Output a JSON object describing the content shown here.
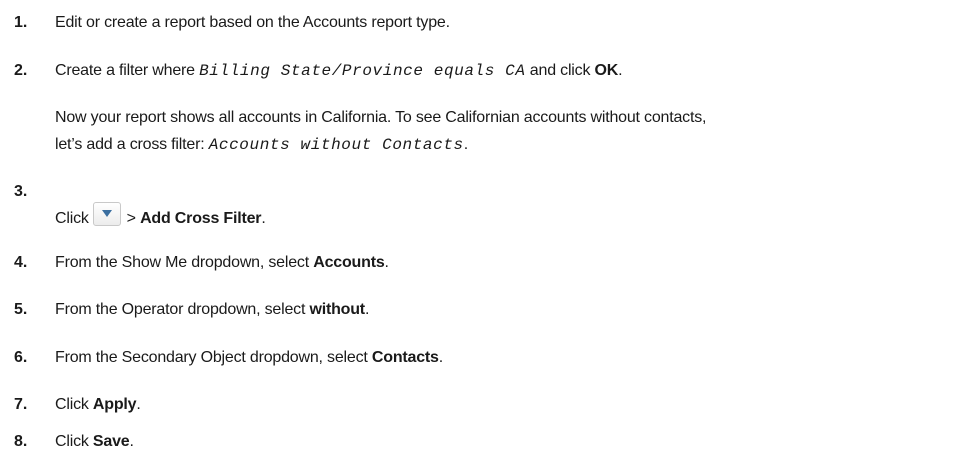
{
  "steps": [
    {
      "num": "1.",
      "text": "Edit or create a report based on the Accounts report type."
    },
    {
      "num": "2.",
      "pre": "Create a filter where ",
      "code": "Billing State/Province equals CA",
      "mid": " and click ",
      "bold": "OK",
      "post": "."
    },
    {
      "note_line1": "Now your report shows all accounts in California. To see Californian accounts without contacts,",
      "note_line2_pre": "let’s add a cross filter: ",
      "note_code": "Accounts without Contacts",
      "note_post": "."
    },
    {
      "num": "3.",
      "pre": "Click",
      "mid": "> ",
      "bold": "Add Cross Filter",
      "post": ".",
      "icon": "dropdown-arrow-icon"
    },
    {
      "num": "4.",
      "pre": "From the Show Me dropdown, select ",
      "bold": "Accounts",
      "post": "."
    },
    {
      "num": "5.",
      "pre": "From the Operator dropdown, select ",
      "bold": "without",
      "post": "."
    },
    {
      "num": "6.",
      "pre": "From the Secondary Object dropdown, select ",
      "bold": "Contacts",
      "post": "."
    },
    {
      "num": "7.",
      "pre": "Click ",
      "bold": "Apply",
      "post": "."
    },
    {
      "num": "8.",
      "pre": "Click ",
      "bold": "Save",
      "post": "."
    }
  ],
  "colors": {
    "text": "#1a1a1a",
    "icon_arrow": "#3b6fa0",
    "button_border": "#c9c9c9"
  }
}
